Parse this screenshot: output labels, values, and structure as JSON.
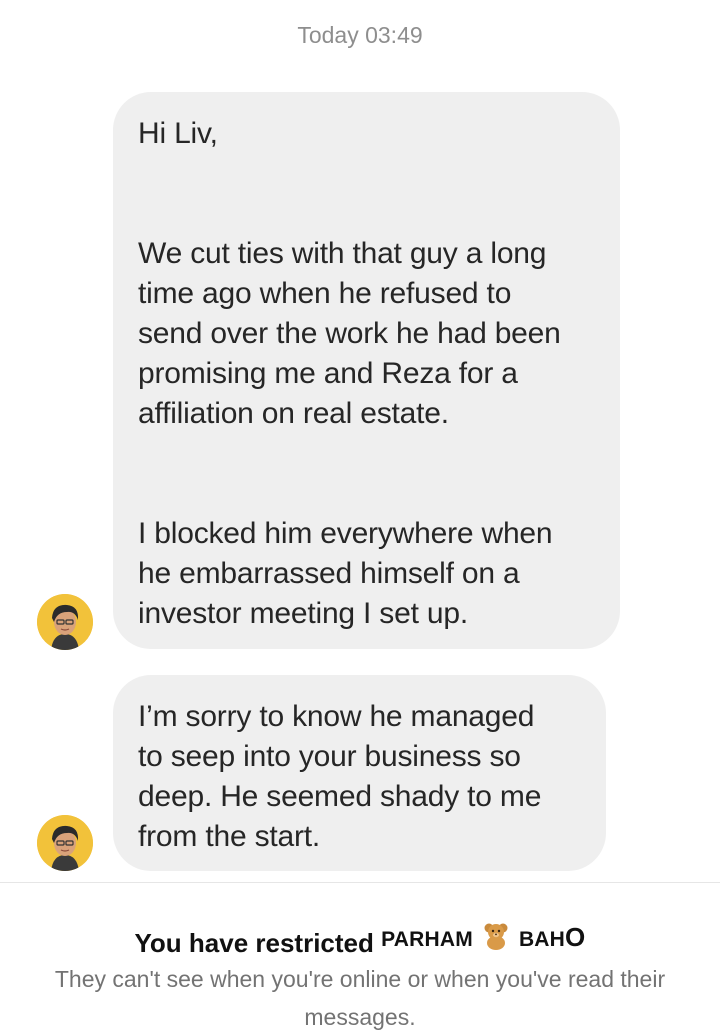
{
  "timestamp": "Today 03:49",
  "messages": [
    {
      "paragraphs": [
        "Hi Liv,",
        "We cut ties with that guy a long\ntime ago when he refused to\nsend over the work he had been\npromising me and Reza for a\naffiliation on real estate.",
        "I blocked him everywhere when\nhe embarrassed himself on a\ninvestor meeting I set up."
      ]
    },
    {
      "paragraphs": [
        "I’m sorry to know he managed\nto seep into your business so\ndeep. He seemed  shady to me\nfrom the start."
      ]
    }
  ],
  "restriction": {
    "prefix": "You have restricted",
    "username_part1": "PARHAM",
    "username_part2": "BAH",
    "username_last": "O",
    "emoji": "teddy-bear-icon",
    "subtitle": "They can't see when you're online or when you've read their messages."
  },
  "colors": {
    "bubble_bg": "#efefef",
    "avatar_bg": "#f2c23a",
    "muted_text": "#8e8e8e"
  }
}
